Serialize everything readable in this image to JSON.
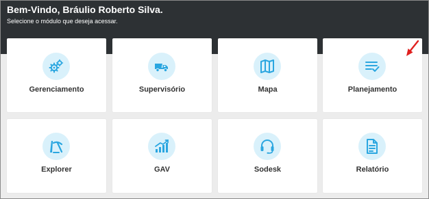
{
  "header": {
    "title": "Bem-Vindo, Bráulio Roberto Silva.",
    "subtitle": "Selecione o módulo que deseja acessar."
  },
  "colors": {
    "header_bg": "#2d3134",
    "icon_bg": "#d9f1fb",
    "icon_fg": "#2aa6e0",
    "arrow": "#e0201f"
  },
  "modules": [
    {
      "label": "Gerenciamento",
      "icon": "gears-icon"
    },
    {
      "label": "Supervisório",
      "icon": "dump-truck-icon"
    },
    {
      "label": "Mapa",
      "icon": "map-icon"
    },
    {
      "label": "Planejamento",
      "icon": "checklist-icon"
    },
    {
      "label": "Explorer",
      "icon": "pickaxe-icon"
    },
    {
      "label": "GAV",
      "icon": "bar-chart-icon"
    },
    {
      "label": "Sodesk",
      "icon": "headset-icon"
    },
    {
      "label": "Relatório",
      "icon": "document-icon"
    }
  ]
}
